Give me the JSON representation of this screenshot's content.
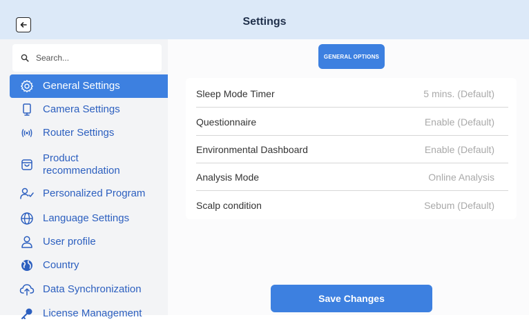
{
  "header": {
    "title": "Settings",
    "back_icon": "arrow-left-icon"
  },
  "search": {
    "placeholder": "Search..."
  },
  "sidebar": {
    "accent": "#3d80e0",
    "items": [
      {
        "label": "General Settings",
        "icon": "gear-icon",
        "active": true
      },
      {
        "label": "Camera Settings",
        "icon": "camera-device-icon"
      },
      {
        "label": "Router Settings",
        "icon": "wifi-broadcast-icon"
      },
      {
        "label": "Product recommendation",
        "icon": "shopping-bag-icon"
      },
      {
        "label": "Personalized Program",
        "icon": "user-check-icon"
      },
      {
        "label": "Language Settings",
        "icon": "globe-icon"
      },
      {
        "label": "User profile",
        "icon": "user-icon"
      },
      {
        "label": "Country",
        "icon": "earth-icon"
      },
      {
        "label": "Data Synchronization",
        "icon": "cloud-upload-icon"
      },
      {
        "label": "License Management",
        "icon": "key-icon"
      }
    ]
  },
  "main": {
    "tab_label": "GENERAL OPTIONS",
    "settings": [
      {
        "label": "Sleep Mode Timer",
        "value": "5 mins. (Default)"
      },
      {
        "label": "Questionnaire",
        "value": "Enable (Default)"
      },
      {
        "label": "Environmental Dashboard",
        "value": "Enable (Default)"
      },
      {
        "label": "Analysis Mode",
        "value": "Online Analysis"
      },
      {
        "label": "Scalp condition",
        "value": "Sebum (Default)"
      }
    ],
    "save_label": "Save Changes"
  }
}
